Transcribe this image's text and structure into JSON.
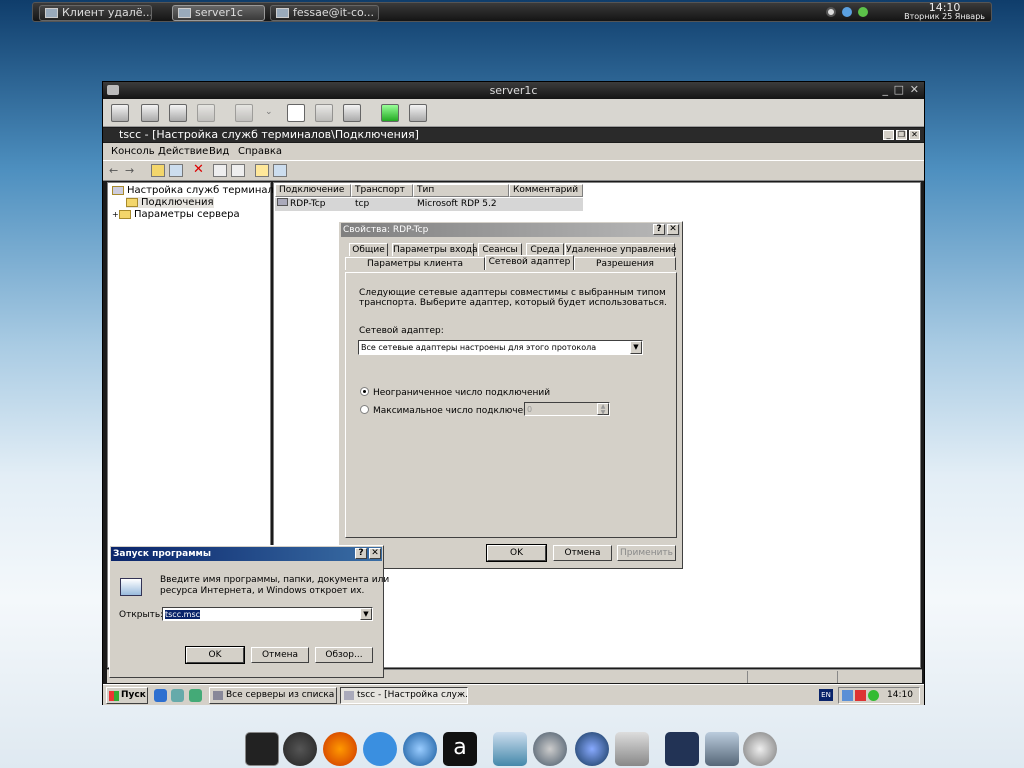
{
  "top_panel": {
    "tabs": [
      {
        "label": "Клиент удалё..."
      },
      {
        "label": "server1c"
      },
      {
        "label": "fessae@it-co..."
      }
    ],
    "clock": {
      "time": "14:10",
      "date": "Вторник 25 Январь"
    }
  },
  "window": {
    "title": "server1c",
    "minimize": "_",
    "maximize": "□",
    "close": "✕"
  },
  "mmc": {
    "title": "tscc - [Настройка служб терминалов\\Подключения]",
    "menu": [
      "Консоль",
      "Действие",
      "Вид",
      "Справка"
    ],
    "tree": {
      "root": "Настройка служб терминалов",
      "items": [
        "Подключения",
        "Параметры сервера"
      ]
    },
    "columns": [
      "Подключение",
      "Транспорт",
      "Тип",
      "Комментарий"
    ],
    "rows": [
      {
        "connection": "RDP-Tcp",
        "transport": "tcp",
        "type": "Microsoft RDP 5.2",
        "comment": ""
      }
    ]
  },
  "props": {
    "title": "Свойства: RDP-Tcp",
    "help": "?",
    "close": "✕",
    "tabs_row1": [
      "Общие",
      "Параметры входа",
      "Сеансы",
      "Среда",
      "Удаленное управление"
    ],
    "tabs_row2": [
      "Параметры клиента",
      "Сетевой адаптер",
      "Разрешения"
    ],
    "selected_tab": "Сетевой адаптер",
    "description": [
      "Следующие сетевые адаптеры совместимы с выбранным типом",
      "транспорта. Выберите адаптер, который будет использоваться."
    ],
    "adapter_label": "Сетевой адаптер:",
    "adapter_value": "Все сетевые адаптеры настроены для этого протокола",
    "radio_unlimited": "Неограниченное число подключений",
    "radio_max": "Максимальное число подключений:",
    "max_value": "0",
    "ok": "OK",
    "cancel": "Отмена",
    "apply": "Применить"
  },
  "run": {
    "title": "Запуск программы",
    "help": "?",
    "close": "✕",
    "description": [
      "Введите имя программы, папки, документа или",
      "ресурса Интернета, и Windows откроет их."
    ],
    "open_label": "Открыть:",
    "open_value": "tscc.msc",
    "ok": "OK",
    "cancel": "Отмена",
    "browse": "Обзор..."
  },
  "taskbar": {
    "start": "Пуск",
    "buttons": [
      "Все серверы из списка ...",
      "tscc - [Настройка служ..."
    ],
    "lang": "EN",
    "time": "14:10"
  },
  "dock": {
    "items": [
      "terminal-icon",
      "chrome-icon",
      "firefox-icon",
      "pidgin-icon",
      "thunderbird-icon",
      "a-app-icon",
      "file-manager-icon",
      "network-icon",
      "browser-icon",
      "screen-icon",
      "window-icon",
      "remote-desktop-icon",
      "trash-icon"
    ]
  }
}
